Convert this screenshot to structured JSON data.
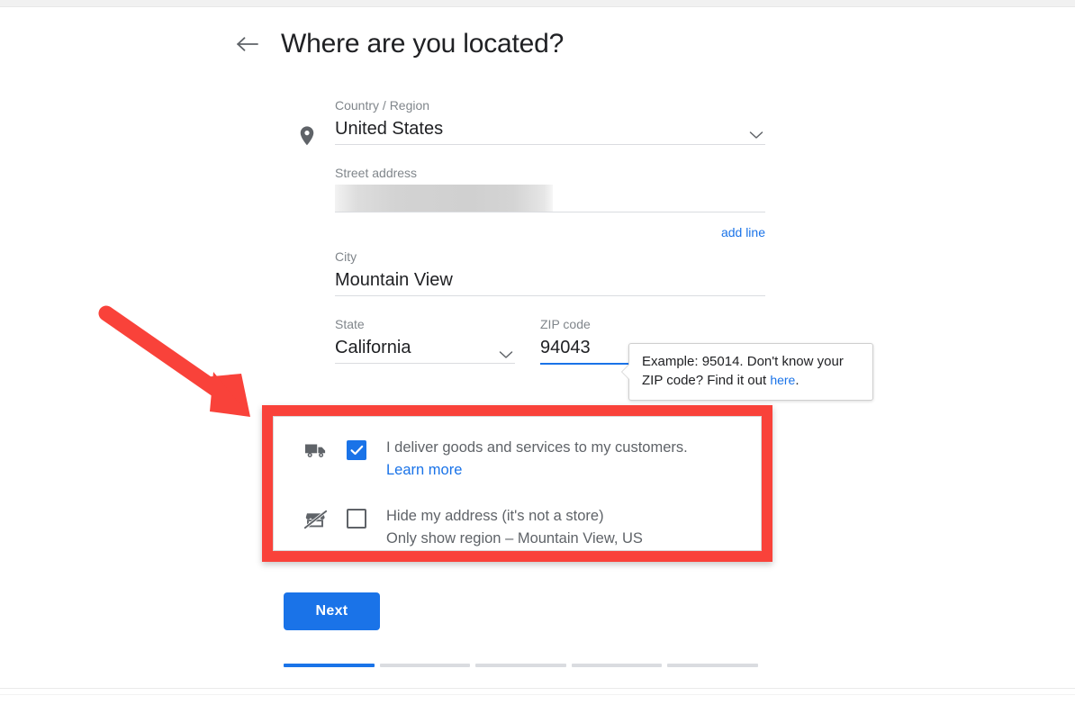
{
  "header": {
    "back_icon": "arrow-left-icon",
    "title": "Where are you located?"
  },
  "form": {
    "location_icon": "map-pin-icon",
    "country": {
      "label": "Country / Region",
      "value": "United States",
      "dropdown_icon": "chevron-down-icon"
    },
    "street": {
      "label": "Street address",
      "value": "",
      "redacted": true
    },
    "add_line_label": "add line",
    "city": {
      "label": "City",
      "value": "Mountain View"
    },
    "state": {
      "label": "State",
      "value": "California",
      "dropdown_icon": "chevron-down-icon"
    },
    "zip": {
      "label": "ZIP code",
      "value": "94043",
      "focused": true
    }
  },
  "tooltip": {
    "text_before": "Example: 95014. Don't know your ZIP code? Find it out ",
    "link": "here",
    "text_after": "."
  },
  "options": [
    {
      "icon": "delivery-truck-icon",
      "checked": true,
      "label": "I deliver goods and services to my customers.",
      "link": "Learn more",
      "sub": ""
    },
    {
      "icon": "store-off-icon",
      "checked": false,
      "label": "Hide my address (it's not a store)",
      "link": "",
      "sub": "Only show region – Mountain View, US"
    }
  ],
  "footer": {
    "next_label": "Next",
    "progress_total": 5,
    "progress_current": 1
  },
  "annotation": {
    "arrow_color": "#f9423a",
    "box_color": "#f9423a"
  },
  "colors": {
    "accent_blue": "#1a73e8",
    "text_primary": "#202124",
    "text_secondary": "#5f6368",
    "label_gray": "#80868b",
    "divider": "#dadce0",
    "annotation_red": "#f9423a"
  }
}
